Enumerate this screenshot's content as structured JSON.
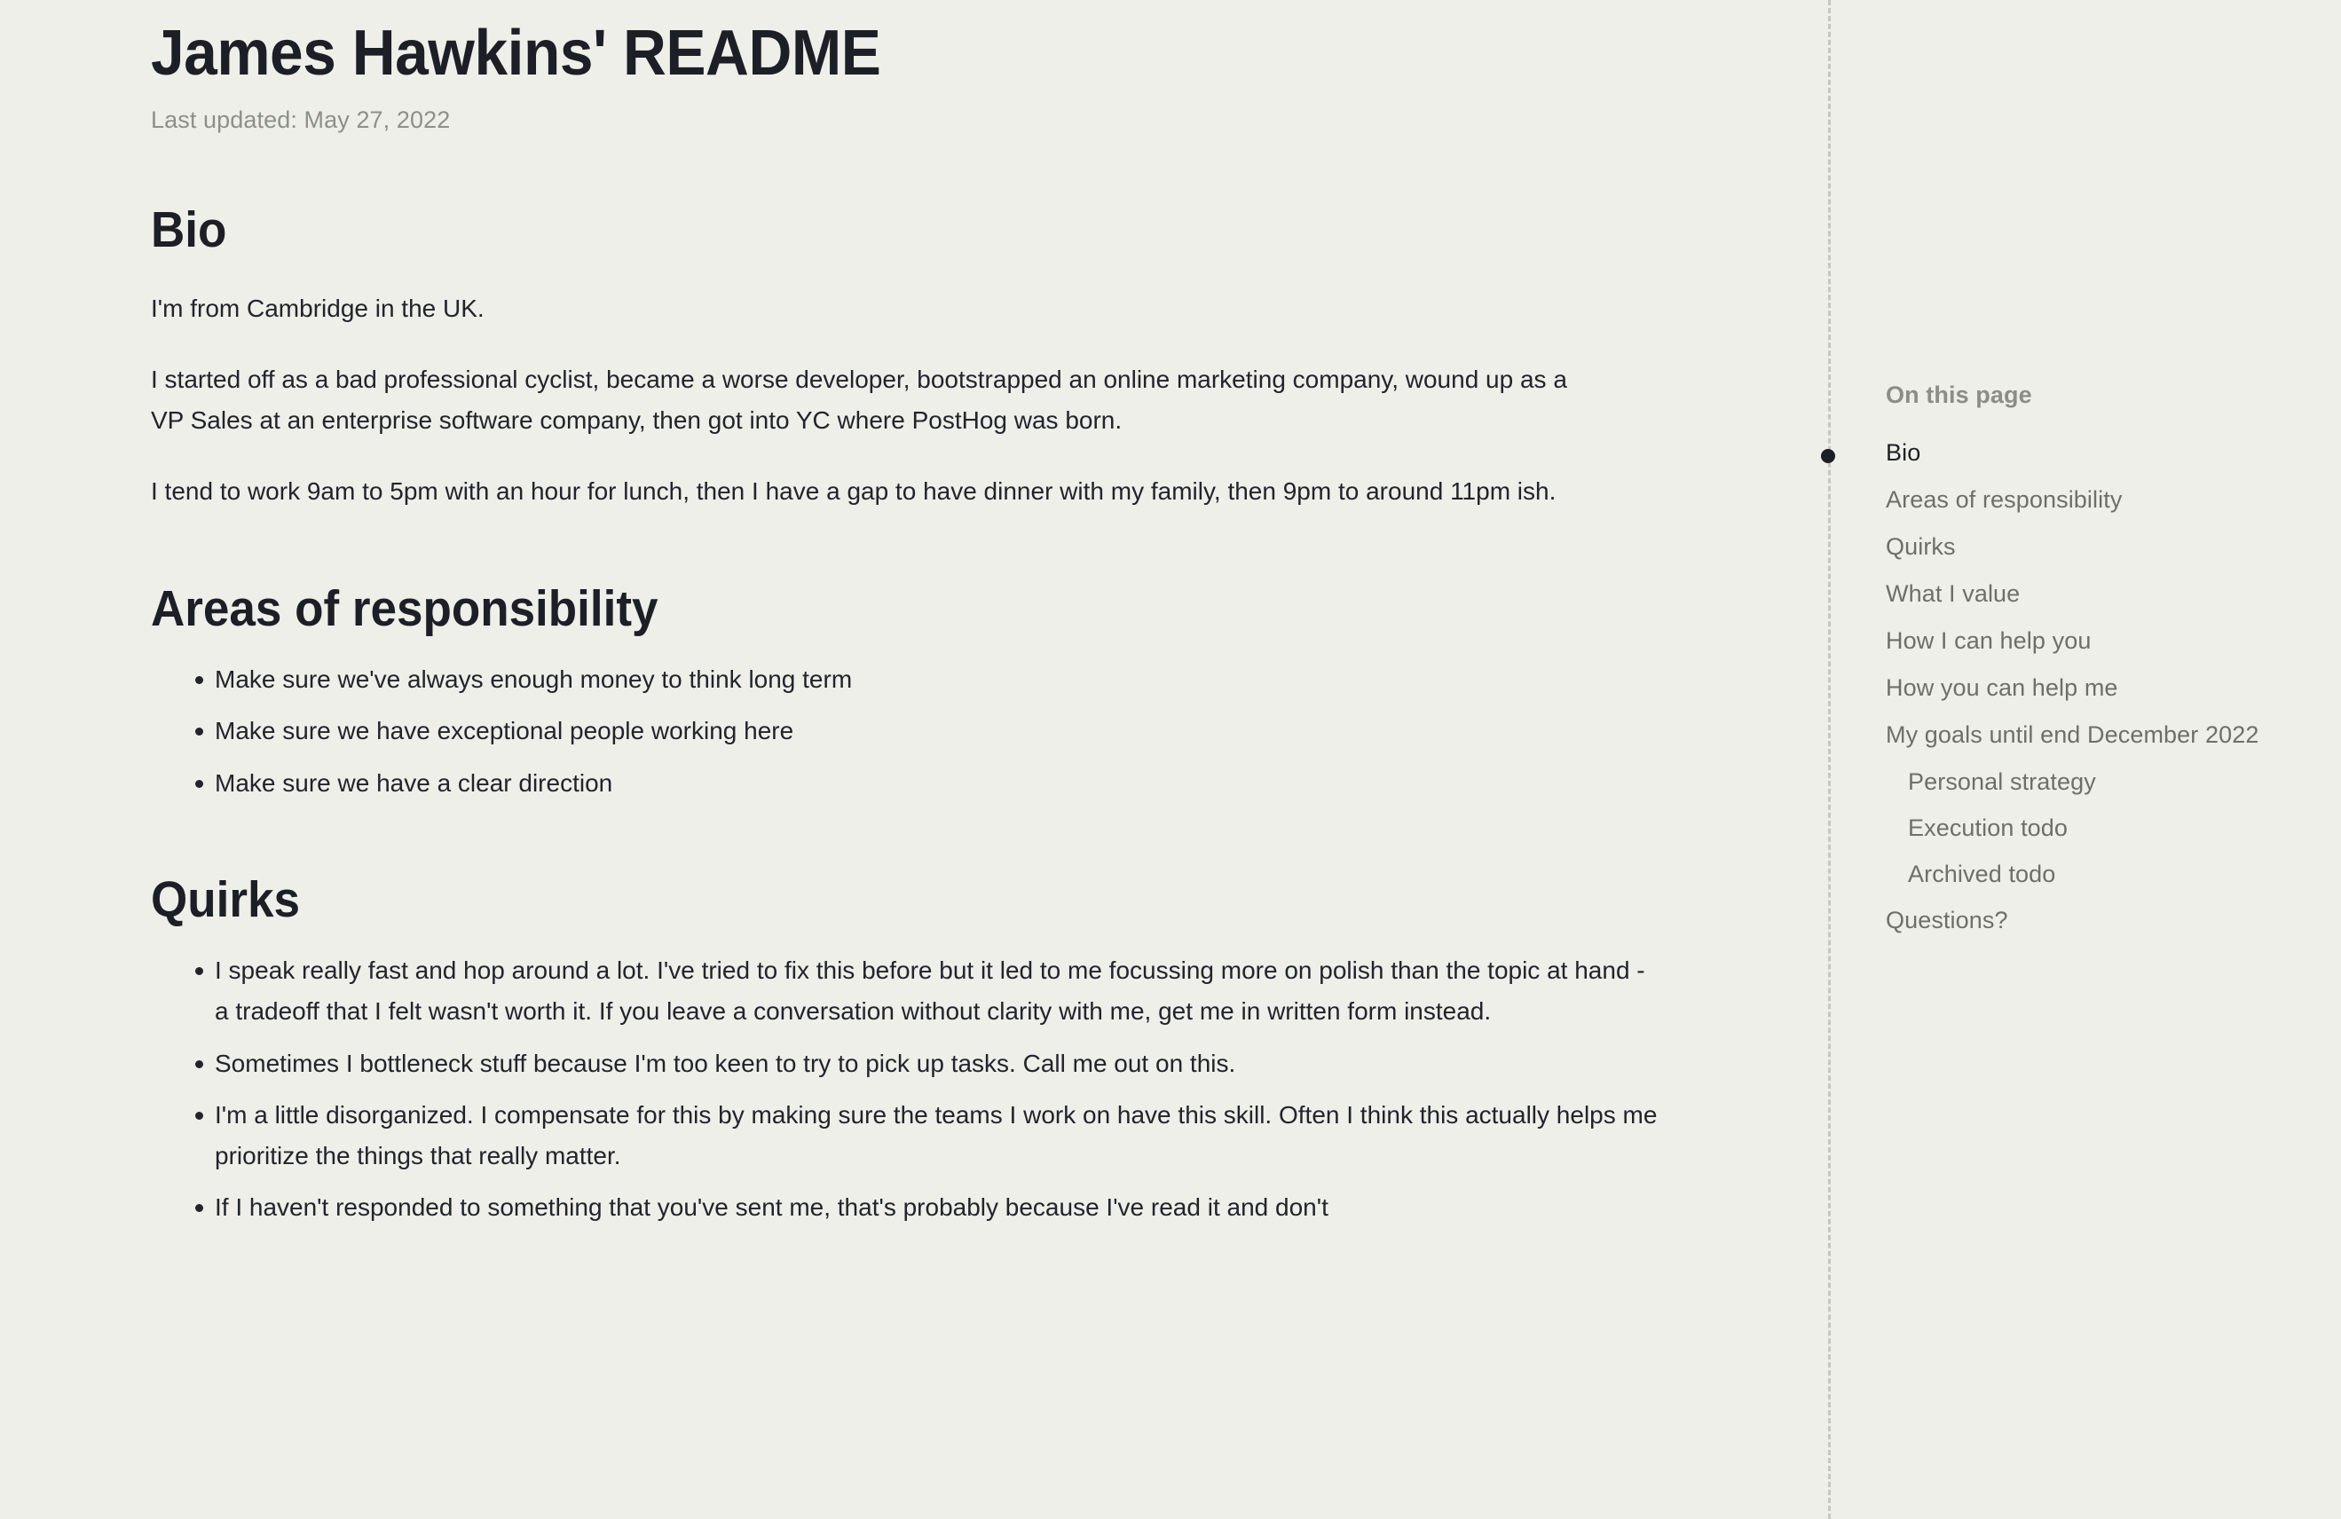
{
  "document": {
    "title": "James Hawkins' README",
    "last_updated": "Last updated: May 27, 2022"
  },
  "sections": {
    "bio": {
      "heading": "Bio",
      "p1": "I'm from Cambridge in the UK.",
      "p2": "I started off as a bad professional cyclist, became a worse developer, bootstrapped an online marketing company, wound up as a VP Sales at an enterprise software company, then got into YC where PostHog was born.",
      "p3": "I tend to work 9am to 5pm with an hour for lunch, then I have a gap to have dinner with my family, then 9pm to around 11pm ish."
    },
    "areas": {
      "heading": "Areas of responsibility",
      "items": [
        "Make sure we've always enough money to think long term",
        "Make sure we have exceptional people working here",
        "Make sure we have a clear direction"
      ]
    },
    "quirks": {
      "heading": "Quirks",
      "items": [
        "I speak really fast and hop around a lot. I've tried to fix this before but it led to me focussing more on polish than the topic at hand - a tradeoff that I felt wasn't worth it. If you leave a conversation without clarity with me, get me in written form instead.",
        "Sometimes I bottleneck stuff because I'm too keen to try to pick up tasks. Call me out on this.",
        "I'm a little disorganized. I compensate for this by making sure the teams I work on have this skill. Often I think this actually helps me prioritize the things that really matter.",
        "If I haven't responded to something that you've sent me, that's probably because I've read it and don't"
      ]
    }
  },
  "toc": {
    "heading": "On this page",
    "items": [
      {
        "label": "Bio",
        "level": 1,
        "active": true
      },
      {
        "label": "Areas of responsibility",
        "level": 1,
        "active": false
      },
      {
        "label": "Quirks",
        "level": 1,
        "active": false
      },
      {
        "label": "What I value",
        "level": 1,
        "active": false
      },
      {
        "label": "How I can help you",
        "level": 1,
        "active": false
      },
      {
        "label": "How you can help me",
        "level": 1,
        "active": false
      },
      {
        "label": "My goals until end December 2022",
        "level": 1,
        "active": false
      },
      {
        "label": "Personal strategy",
        "level": 2,
        "active": false
      },
      {
        "label": "Execution todo",
        "level": 2,
        "active": false
      },
      {
        "label": "Archived todo",
        "level": 2,
        "active": false
      },
      {
        "label": "Questions?",
        "level": 1,
        "active": false
      }
    ]
  },
  "colors": {
    "background": "#eeefe9",
    "heading_text": "#1d1f27",
    "body_text": "#22242c",
    "muted_text": "#8d8f89",
    "toc_text": "#6d6f68",
    "rule": "#c6c7c0"
  }
}
